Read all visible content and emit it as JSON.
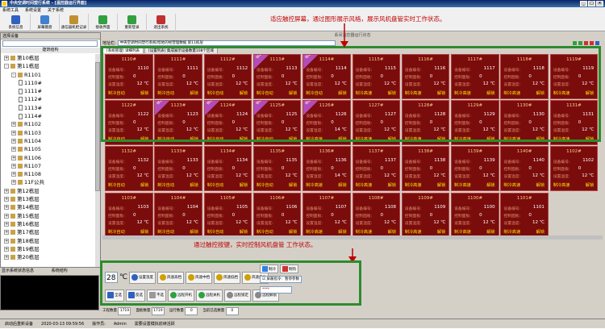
{
  "window": {
    "title": "中央空调时间塑行系统 - [温控器运行界面]"
  },
  "menu": [
    "系统工具",
    "系统设置",
    "关于系统"
  ],
  "toolbar": [
    {
      "label": "系统信息",
      "icon": "info-icon",
      "color": "#3060c0"
    },
    {
      "label": "屏幕键盘",
      "icon": "keyboard-icon",
      "color": "#4080d0"
    },
    {
      "label": "通信器机柜记录",
      "icon": "cabinet-icon",
      "color": "#c09030"
    },
    {
      "label": "接收界面",
      "icon": "receive-icon",
      "color": "#30a040"
    },
    {
      "label": "重新登录",
      "icon": "relogin-icon",
      "color": "#30a040"
    },
    {
      "label": "退出系统",
      "icon": "exit-icon",
      "color": "#c03030"
    }
  ],
  "left": {
    "tab": "选择设备",
    "subtitle": "建筑结构",
    "tree": [
      {
        "label": "第10栋层",
        "level": 1,
        "type": "bld",
        "exp": "+"
      },
      {
        "label": "第11栋层",
        "level": 1,
        "type": "bld",
        "exp": "-"
      },
      {
        "label": "R1101",
        "level": 2,
        "type": "bld",
        "exp": "-"
      },
      {
        "label": "1110#",
        "level": 3,
        "type": "doc",
        "exp": ""
      },
      {
        "label": "1111#",
        "level": 3,
        "type": "doc",
        "exp": ""
      },
      {
        "label": "1112#",
        "level": 3,
        "type": "doc",
        "exp": ""
      },
      {
        "label": "1113#",
        "level": 3,
        "type": "doc",
        "exp": ""
      },
      {
        "label": "1114#",
        "level": 3,
        "type": "doc",
        "exp": ""
      },
      {
        "label": "R1102",
        "level": 2,
        "type": "bld",
        "exp": "+"
      },
      {
        "label": "R1103",
        "level": 2,
        "type": "bld",
        "exp": "+"
      },
      {
        "label": "R1104",
        "level": 2,
        "type": "bld",
        "exp": "+"
      },
      {
        "label": "R1105",
        "level": 2,
        "type": "bld",
        "exp": "+"
      },
      {
        "label": "R1106",
        "level": 2,
        "type": "bld",
        "exp": "+"
      },
      {
        "label": "R1107",
        "level": 2,
        "type": "bld",
        "exp": "+"
      },
      {
        "label": "R1108",
        "level": 2,
        "type": "bld",
        "exp": "+"
      },
      {
        "label": "11F公共",
        "level": 2,
        "type": "bld",
        "exp": "+"
      },
      {
        "label": "第12栋层",
        "level": 1,
        "type": "bld",
        "exp": "+"
      },
      {
        "label": "第13栋层",
        "level": 1,
        "type": "bld",
        "exp": "+"
      },
      {
        "label": "第14栋层",
        "level": 1,
        "type": "bld",
        "exp": "+"
      },
      {
        "label": "第15栋层",
        "level": 1,
        "type": "bld",
        "exp": "+"
      },
      {
        "label": "第16栋层",
        "level": 1,
        "type": "bld",
        "exp": "+"
      },
      {
        "label": "第17栋层",
        "level": 1,
        "type": "bld",
        "exp": "+"
      },
      {
        "label": "第18栋层",
        "level": 1,
        "type": "bld",
        "exp": "+"
      },
      {
        "label": "第19栋层",
        "level": 1,
        "type": "bld",
        "exp": "+"
      },
      {
        "label": "第20栋层",
        "level": 1,
        "type": "bld",
        "exp": "+"
      }
    ],
    "log_label": "显示系统状态信息",
    "log_title": "系统结构"
  },
  "main": {
    "title": "系间温控器运行状态",
    "addr_label": "地址栏:",
    "addr_value": "中央空调时间塑行系统/暗地的经营理数据 第11栋层",
    "tabs": [
      "[系统管理] 详细列表",
      "[设置列表] 集成展示设备数量108个区域"
    ]
  },
  "tile_labels": {
    "l1": "设备编号:",
    "l2": "控制面板:",
    "l3": "设置温度:",
    "mode": "制冷自动",
    "lock": "解锁",
    "zero": "0",
    "ribbon": "锁定"
  },
  "tiles": [
    {
      "num": "1110#",
      "code": "1110",
      "temp": "12 ℃",
      "mode": "制冷自动",
      "ribbon": false
    },
    {
      "num": "1111#",
      "code": "1111",
      "temp": "12 ℃",
      "mode": "制冷自动",
      "ribbon": false
    },
    {
      "num": "1112#",
      "code": "1112",
      "temp": "12 ℃",
      "mode": "制冷自动",
      "ribbon": false
    },
    {
      "num": "1113#",
      "code": "1113",
      "temp": "12 ℃",
      "mode": "制冷自动",
      "ribbon": true
    },
    {
      "num": "1114#",
      "code": "1114",
      "temp": "12 ℃",
      "mode": "制冷自动",
      "ribbon": true
    },
    {
      "num": "1115#",
      "code": "1115",
      "temp": "12 ℃",
      "mode": "制冷高速",
      "ribbon": false
    },
    {
      "num": "1116#",
      "code": "1116",
      "temp": "12 ℃",
      "mode": "制冷高速",
      "ribbon": false
    },
    {
      "num": "1117#",
      "code": "1117",
      "temp": "12 ℃",
      "mode": "制冷高速",
      "ribbon": false
    },
    {
      "num": "1118#",
      "code": "1118",
      "temp": "12 ℃",
      "mode": "制冷高速",
      "ribbon": false
    },
    {
      "num": "1119#",
      "code": "1119",
      "temp": "12 ℃",
      "mode": "制冷高速",
      "ribbon": false
    },
    {
      "num": "1122#",
      "code": "1122",
      "temp": "12 ℃",
      "mode": "制冷自动",
      "ribbon": false
    },
    {
      "num": "1123#",
      "code": "1123",
      "temp": "12 ℃",
      "mode": "制冷自动",
      "ribbon": true
    },
    {
      "num": "1124#",
      "code": "1124",
      "temp": "12 ℃",
      "mode": "制冷自动",
      "ribbon": true
    },
    {
      "num": "1125#",
      "code": "1125",
      "temp": "12 ℃",
      "mode": "制冷自动",
      "ribbon": true
    },
    {
      "num": "1126#",
      "code": "1126",
      "temp": "14 ℃",
      "mode": "制冷高速",
      "ribbon": true
    },
    {
      "num": "1127#",
      "code": "1127",
      "temp": "12 ℃",
      "mode": "制冷高速",
      "ribbon": false
    },
    {
      "num": "1128#",
      "code": "1128",
      "temp": "12 ℃",
      "mode": "制冷高速",
      "ribbon": false
    },
    {
      "num": "1129#",
      "code": "1129",
      "temp": "12 ℃",
      "mode": "制冷高速",
      "ribbon": false
    },
    {
      "num": "1130#",
      "code": "1130",
      "temp": "12 ℃",
      "mode": "制冷高速",
      "ribbon": false
    },
    {
      "num": "1131#",
      "code": "1131",
      "temp": "12 ℃",
      "mode": "制冷高速",
      "ribbon": false
    },
    {
      "num": "1132#",
      "code": "1132",
      "temp": "12 ℃",
      "mode": "制冷自动",
      "ribbon": false
    },
    {
      "num": "1133#",
      "code": "1133",
      "temp": "12 ℃",
      "mode": "制冷自动",
      "ribbon": false
    },
    {
      "num": "1134#",
      "code": "1134",
      "temp": "12 ℃",
      "mode": "制冷自动",
      "ribbon": false
    },
    {
      "num": "1135#",
      "code": "1135",
      "temp": "12 ℃",
      "mode": "制冷自动",
      "ribbon": false
    },
    {
      "num": "1136#",
      "code": "1136",
      "temp": "14 ℃",
      "mode": "制冷高速",
      "ribbon": false
    },
    {
      "num": "1137#",
      "code": "1137",
      "temp": "12 ℃",
      "mode": "制冷高速",
      "ribbon": false
    },
    {
      "num": "1138#",
      "code": "1138",
      "temp": "12 ℃",
      "mode": "制冷高速",
      "ribbon": false
    },
    {
      "num": "1139#",
      "code": "1139",
      "temp": "12 ℃",
      "mode": "制冷高速",
      "ribbon": false
    },
    {
      "num": "1140#",
      "code": "1140",
      "temp": "12 ℃",
      "mode": "制冷高速",
      "ribbon": false
    },
    {
      "num": "1102#",
      "code": "1102",
      "temp": "12 ℃",
      "mode": "制冷高速",
      "ribbon": false
    },
    {
      "num": "1103#",
      "code": "1103",
      "temp": "12 ℃",
      "mode": "制冷自动",
      "ribbon": false
    },
    {
      "num": "1104#",
      "code": "1104",
      "temp": "12 ℃",
      "mode": "制冷自动",
      "ribbon": false
    },
    {
      "num": "1105#",
      "code": "1105",
      "temp": "12 ℃",
      "mode": "制冷自动",
      "ribbon": false
    },
    {
      "num": "1106#",
      "code": "1106",
      "temp": "12 ℃",
      "mode": "制冷自动",
      "ribbon": false
    },
    {
      "num": "1107#",
      "code": "1107",
      "temp": "12 ℃",
      "mode": "制冷高速",
      "ribbon": false
    },
    {
      "num": "1108#",
      "code": "1108",
      "temp": "12 ℃",
      "mode": "制冷高速",
      "ribbon": false
    },
    {
      "num": "1109#",
      "code": "1109",
      "temp": "12 ℃",
      "mode": "制冷高速",
      "ribbon": false
    },
    {
      "num": "1100#",
      "code": "1100",
      "temp": "12 ℃",
      "mode": "制冷高速",
      "ribbon": false
    },
    {
      "num": "1101#",
      "code": "1101",
      "temp": "12 ℃",
      "mode": "制冷高速",
      "ribbon": false
    }
  ],
  "annotations": {
    "top": "适应触控屏幕，通过图形展示风格，展示风机盘管实时工作状态。",
    "bottom": "通过触控按键，实时控制风机盘管 工作状态。"
  },
  "control": {
    "temp_value": "28",
    "temp_unit": "℃",
    "row1": [
      {
        "label": "设置温度",
        "color": "#3060c0"
      },
      {
        "label": "风速高档",
        "color": "#d0a000"
      },
      {
        "label": "风速中档",
        "color": "#d0a000"
      },
      {
        "label": "风速低档",
        "color": "#d0a000"
      },
      {
        "label": "风速自动",
        "color": "#d0a000"
      },
      {
        "label": "制冷",
        "color": "#3080e0"
      },
      {
        "label": "制热",
        "color": "#d03030"
      }
    ],
    "row2": [
      {
        "label": "全选",
        "color": "#3060c0"
      },
      {
        "label": "反选",
        "color": "#3060c0"
      },
      {
        "label": "不选",
        "color": "#999999"
      },
      {
        "label": "远程开机",
        "color": "#30a040"
      },
      {
        "label": "远程关机",
        "color": "#30a040"
      },
      {
        "label": "远程锁定",
        "color": "#888888"
      },
      {
        "label": "远程解锁",
        "color": "#888888"
      }
    ],
    "check1": "屏蔽指令：暂停参数",
    "check2": "****"
  },
  "counters": [
    {
      "label": "工程数量",
      "value": "1719"
    },
    {
      "label": "面板数量",
      "value": "1719"
    },
    {
      "label": "运行数量",
      "value": "0"
    },
    {
      "label": "当前已选数量",
      "value": "0"
    }
  ],
  "status": {
    "items": [
      "启动后重新设备",
      "2020-03-13 09:59:56",
      "操作员:",
      "Admin",
      "需要设置模拟前续活跃"
    ]
  }
}
